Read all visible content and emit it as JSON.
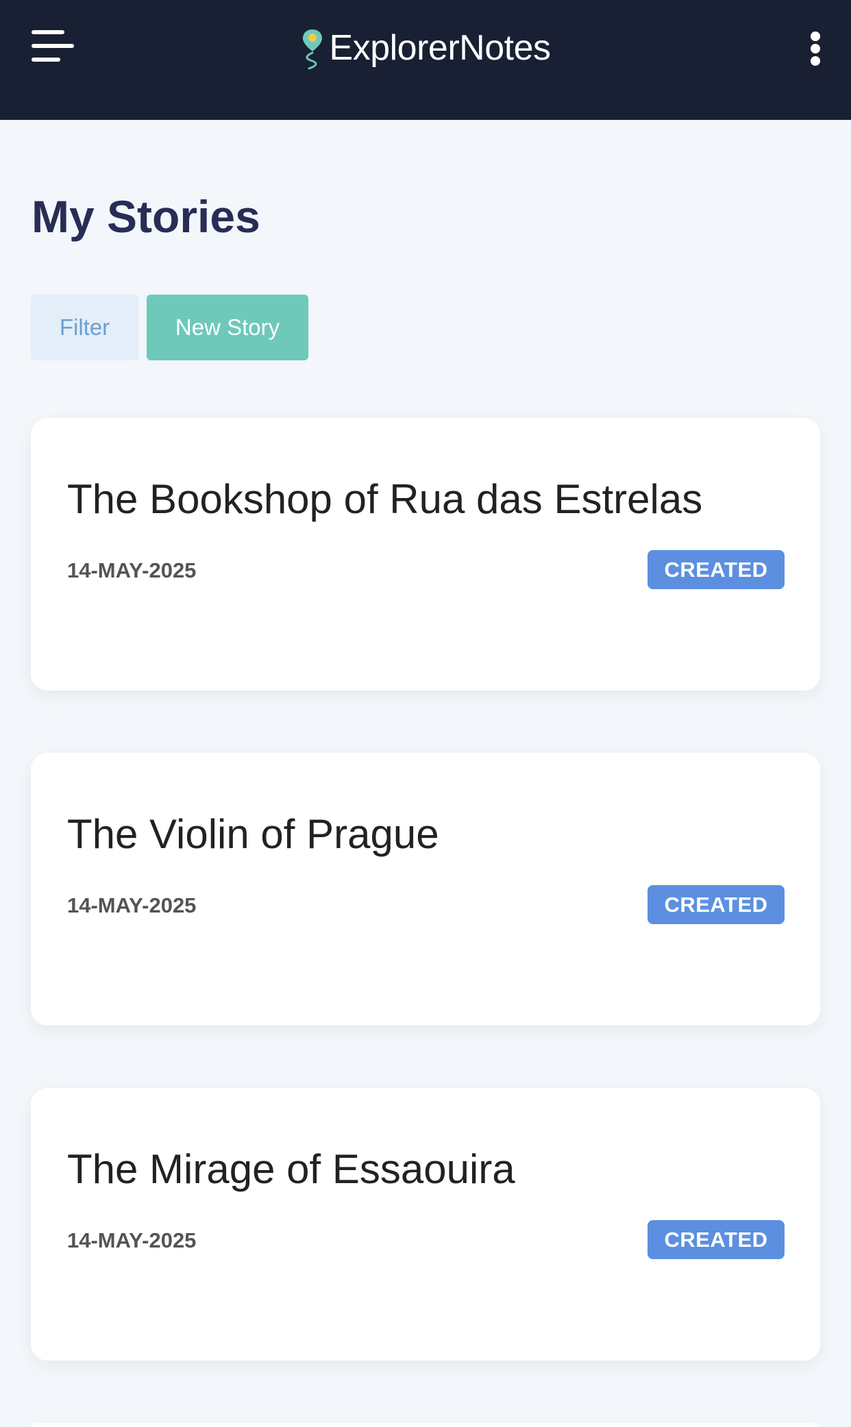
{
  "app": {
    "name": "ExplorerNotes",
    "menu_icon": "hamburger-menu-icon",
    "logo_icon": "map-pin-route-icon",
    "more_icon": "vertical-dots-icon"
  },
  "page": {
    "title": "My Stories"
  },
  "actions": {
    "filter_label": "Filter",
    "new_story_label": "New Story"
  },
  "stories": [
    {
      "title": "The Bookshop of Rua das Estrelas",
      "date": "14-MAY-2025",
      "status": "CREATED"
    },
    {
      "title": "The Violin of Prague",
      "date": "14-MAY-2025",
      "status": "CREATED"
    },
    {
      "title": "The Mirage of Essaouira",
      "date": "14-MAY-2025",
      "status": "CREATED"
    }
  ],
  "colors": {
    "header_bg": "#1a2033",
    "page_bg": "#f3f6fa",
    "title_color": "#272d55",
    "accent_teal": "#6ec9ba",
    "filter_bg": "#e3eef9",
    "filter_text": "#6d9fd0",
    "badge_bg": "#5c8fe0"
  }
}
